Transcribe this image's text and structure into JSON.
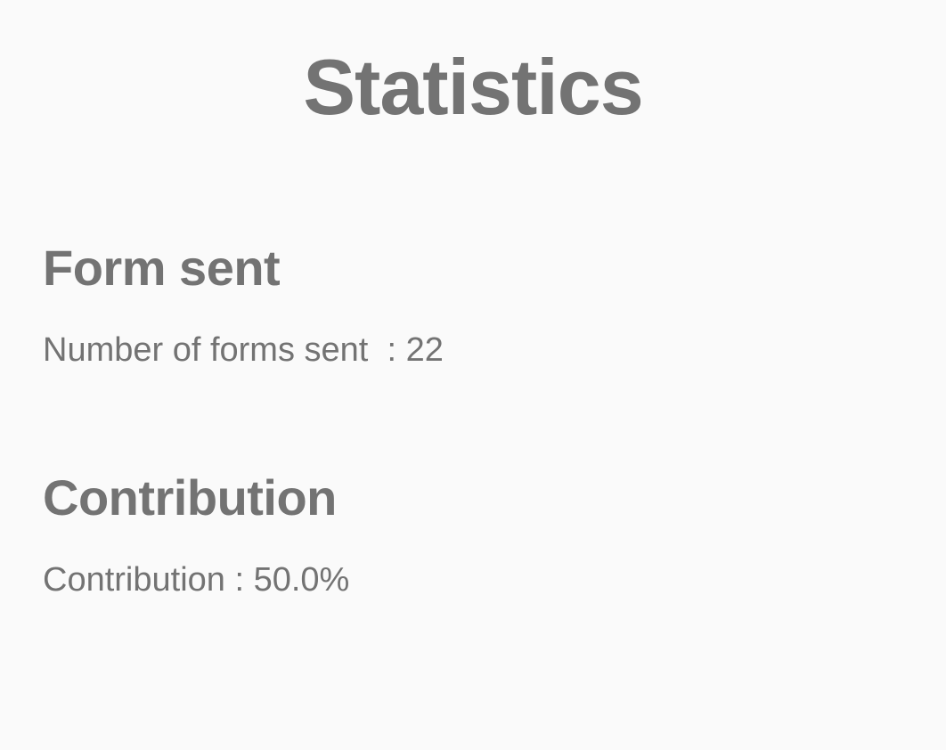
{
  "page": {
    "title": "Statistics"
  },
  "sections": [
    {
      "title": "Form sent",
      "label": "Number of forms sent  : ",
      "value": "22"
    },
    {
      "title": "Contribution",
      "label": "Contribution : ",
      "value": "50.0%"
    }
  ],
  "colors": {
    "background": "#fafafa",
    "text": "#737373"
  }
}
